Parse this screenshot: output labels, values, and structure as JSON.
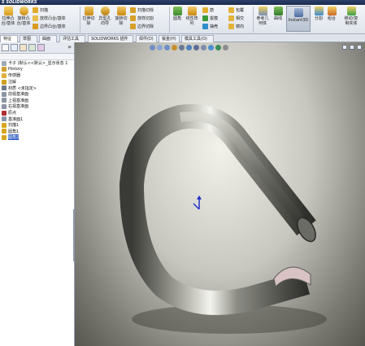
{
  "app": {
    "title": "S SOLIDWORKS"
  },
  "ribbon": {
    "left_buttons": [
      {
        "label": "拉伸凸\n台/基体",
        "icon": "extrude-boss-icon"
      },
      {
        "label": "旋转凸\n台/基体",
        "icon": "revolve-boss-icon"
      }
    ],
    "small_left": [
      {
        "label": "扫描",
        "icon": "sweep-icon"
      },
      {
        "label": "放样凸台/基体",
        "icon": "loft-icon"
      },
      {
        "label": "边界凸台/基体",
        "icon": "boundary-boss-icon"
      }
    ],
    "cut_buttons": [
      {
        "label": "拉伸切\n除",
        "icon": "extrude-cut-icon"
      },
      {
        "label": "异型孔\n向导",
        "icon": "hole-wizard-icon"
      },
      {
        "label": "旋转切\n除",
        "icon": "revolve-cut-icon"
      }
    ],
    "small_cut": [
      {
        "label": "扫描切除",
        "icon": "swept-cut-icon"
      },
      {
        "label": "放样切割",
        "icon": "lofted-cut-icon"
      },
      {
        "label": "边界切除",
        "icon": "boundary-cut-icon"
      }
    ],
    "feature_buttons": [
      {
        "label": "圆角",
        "icon": "fillet-icon"
      },
      {
        "label": "线性阵\n列",
        "icon": "linear-pattern-icon"
      }
    ],
    "small_feature": [
      {
        "label": "筋",
        "icon": "rib-icon"
      },
      {
        "label": "拔模",
        "icon": "draft-icon"
      },
      {
        "label": "抽壳",
        "icon": "shell-icon"
      }
    ],
    "small_feature2": [
      {
        "label": "包覆",
        "icon": "wrap-icon"
      },
      {
        "label": "相交",
        "icon": "intersect-icon"
      },
      {
        "label": "镜向",
        "icon": "mirror-icon"
      }
    ],
    "right_buttons": [
      {
        "label": "参考几\n何体",
        "icon": "reference-geometry-icon"
      },
      {
        "label": "曲线",
        "icon": "curves-icon"
      },
      {
        "label": "Instant3D",
        "icon": "instant3d-icon"
      },
      {
        "label": "分割",
        "icon": "split-icon"
      },
      {
        "label": "组合",
        "icon": "combine-icon"
      },
      {
        "label": "移动/复\n制实体",
        "icon": "move-copy-body-icon"
      }
    ]
  },
  "tabs": [
    {
      "label": "特征",
      "active": true
    },
    {
      "label": "草图"
    },
    {
      "label": "曲面"
    },
    {
      "label": "评估工具"
    },
    {
      "label": "SOLIDWORKS 插件"
    },
    {
      "label": "焊件(D)"
    },
    {
      "label": "钣金(H)"
    },
    {
      "label": "模具工具(O)"
    }
  ],
  "feature_tree": [
    {
      "label": "卡子 (默认<<默认>_显示状态 1",
      "icon": "part-icon",
      "color": "#a0a8b8"
    },
    {
      "label": "History",
      "icon": "history-icon",
      "color": "#d0a030"
    },
    {
      "label": "传感器",
      "icon": "sensor-icon",
      "color": "#e0b040"
    },
    {
      "label": "注解",
      "icon": "annotations-icon",
      "color": "#d0a020"
    },
    {
      "label": "材质 <未指定>",
      "icon": "material-icon",
      "color": "#6d7a8c"
    },
    {
      "label": "前视基准面",
      "icon": "plane-icon",
      "color": "#8b95a6"
    },
    {
      "label": "上视基准面",
      "icon": "plane-icon",
      "color": "#8b95a6"
    },
    {
      "label": "右视基准面",
      "icon": "plane-icon",
      "color": "#8b95a6"
    },
    {
      "label": "原点",
      "icon": "origin-icon",
      "color": "#b03030"
    },
    {
      "label": "基准面1",
      "icon": "plane-icon",
      "color": "#8b95a6"
    },
    {
      "label": "扫描1",
      "icon": "sweep-icon",
      "color": "#d9a520"
    },
    {
      "label": "圆角1",
      "icon": "fillet-icon",
      "color": "#d9a520"
    },
    {
      "label": "圆角2",
      "icon": "fillet-icon",
      "color": "#d9a520",
      "selected": true
    }
  ],
  "colors": {
    "accent": "#3160c4",
    "tab_border": "#a9b2c2",
    "model": "#8a8a85"
  }
}
